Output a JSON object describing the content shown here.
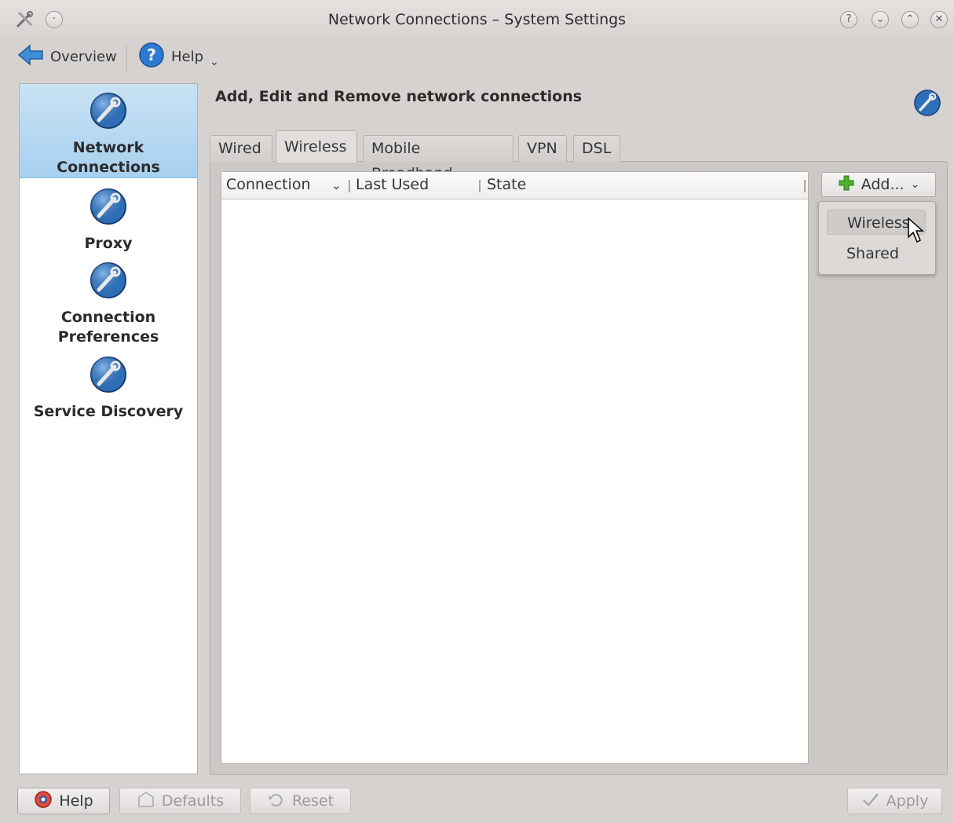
{
  "window": {
    "title": "Network Connections – System Settings",
    "buttons": [
      "?",
      "⌄",
      "⌃",
      "✕"
    ]
  },
  "toolbar": {
    "overview_label": "Overview",
    "help_label": "Help"
  },
  "sidebar": {
    "items": [
      {
        "line1": "Network",
        "line2": "Connections",
        "selected": true
      },
      {
        "line1": "Proxy",
        "line2": ""
      },
      {
        "line1": "Connection",
        "line2": "Preferences"
      },
      {
        "line1": "Service Discovery",
        "line2": ""
      }
    ]
  },
  "main": {
    "header": "Add, Edit and Remove network connections",
    "tabs": [
      {
        "label": "Wired"
      },
      {
        "label": "Wireless",
        "active": true
      },
      {
        "label": "Mobile Broadband"
      },
      {
        "label": "VPN"
      },
      {
        "label": "DSL"
      }
    ],
    "columns": [
      "Connection",
      "Last Used",
      "State"
    ],
    "add_button": "Add...",
    "menu": [
      "Wireless",
      "Shared"
    ]
  },
  "footer": {
    "help": "Help",
    "defaults": "Defaults",
    "reset": "Reset",
    "apply": "Apply"
  },
  "colors": {
    "accent": "#a7d0ef",
    "plus_green": "#4caf2e"
  }
}
